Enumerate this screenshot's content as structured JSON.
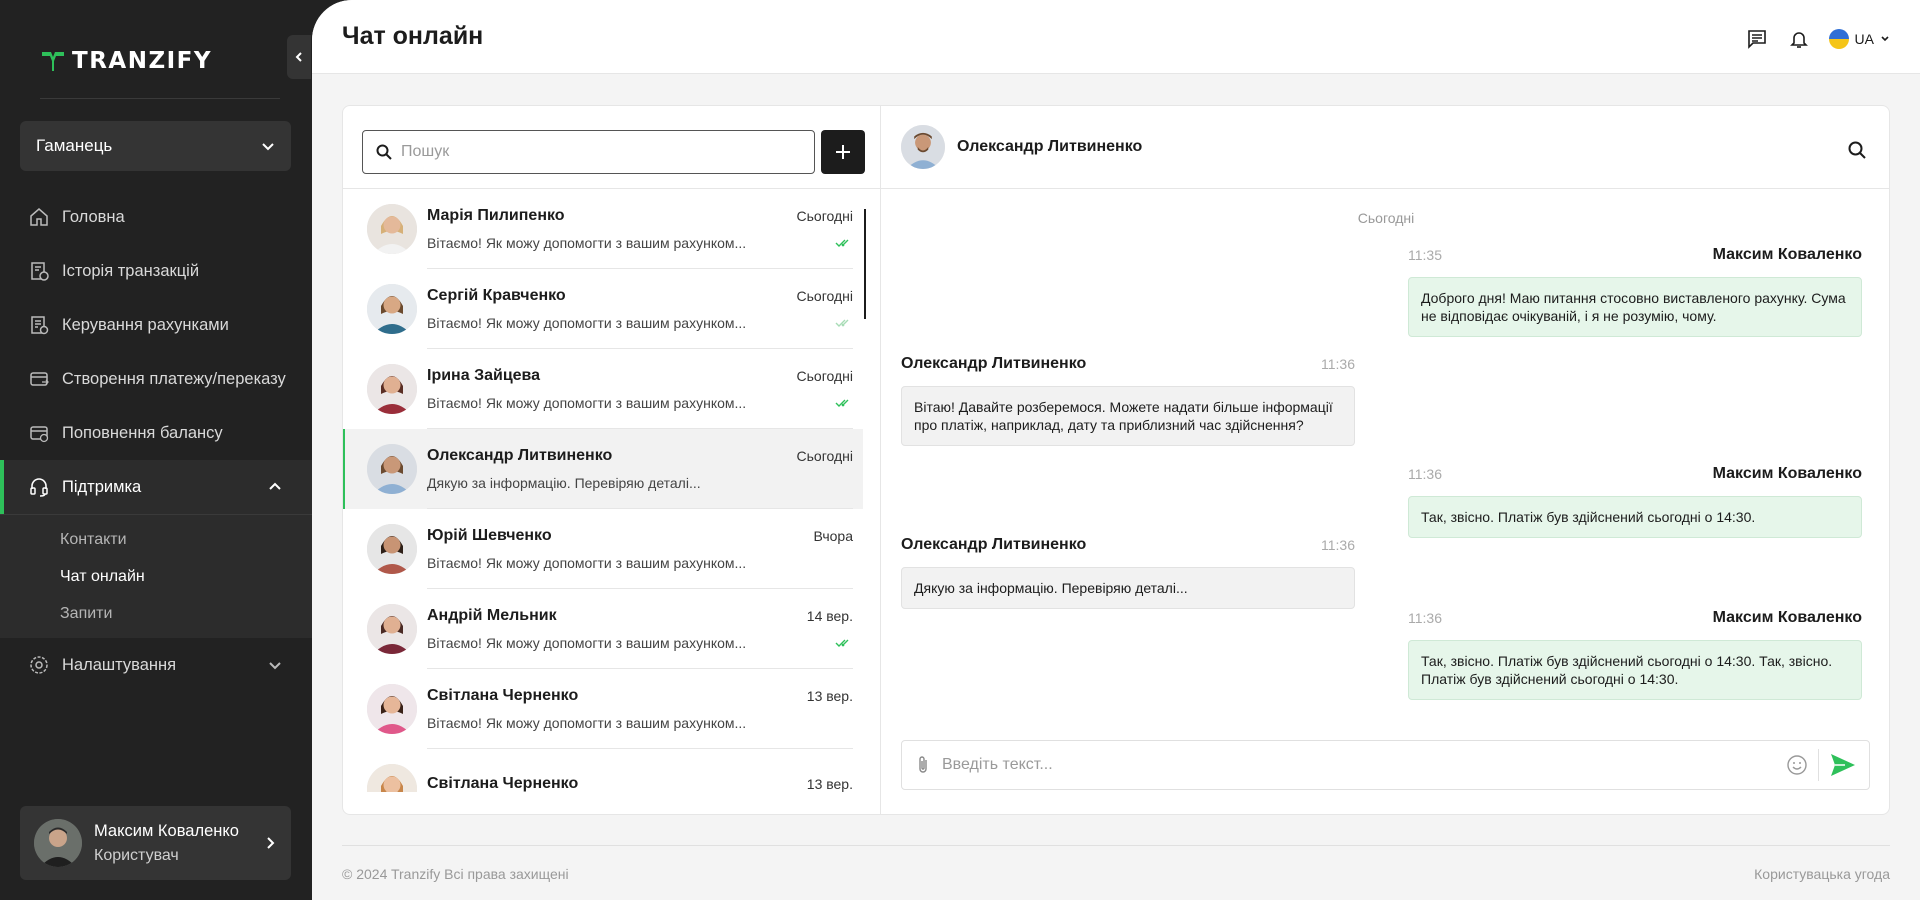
{
  "app": {
    "brand": "TRANZIFY",
    "accent_color": "#2ec05a",
    "sidebar_bg": "#222222"
  },
  "sidebar": {
    "wallet_label": "Гаманець",
    "nav": [
      {
        "label": "Головна",
        "icon": "home-icon"
      },
      {
        "label": "Історія транзакцій",
        "icon": "history-icon"
      },
      {
        "label": "Керування рахунками",
        "icon": "accounts-icon"
      },
      {
        "label": "Створення платежу/переказу",
        "icon": "payment-icon"
      },
      {
        "label": "Поповнення балансу",
        "icon": "topup-icon"
      },
      {
        "label": "Підтримка",
        "icon": "headset-icon",
        "active": true
      },
      {
        "label": "Налаштування",
        "icon": "gear-icon"
      }
    ],
    "support_sub": [
      "Контакти",
      "Чат онлайн",
      "Запити"
    ],
    "user": {
      "name": "Максим Коваленко",
      "role": "Користувач"
    }
  },
  "header": {
    "title": "Чат онлайн",
    "language": "UA"
  },
  "chat_list": {
    "search_placeholder": "Пошук",
    "items": [
      {
        "name": "Марія Пилипенко",
        "time": "Сьогодні",
        "preview": "Вітаємо! Як можу допомогти з вашим рахунком...",
        "status": "read"
      },
      {
        "name": "Сергій Кравченко",
        "time": "Сьогодні",
        "preview": "Вітаємо! Як можу допомогти з вашим рахунком...",
        "status": "delivered"
      },
      {
        "name": "Ірина Зайцева",
        "time": "Сьогодні",
        "preview": "Вітаємо! Як можу допомогти з вашим рахунком...",
        "status": "read"
      },
      {
        "name": "Олександр Литвиненко",
        "time": "Сьогодні",
        "preview": "Дякую за інформацію. Перевіряю деталі...",
        "status": "none",
        "active": true
      },
      {
        "name": "Юрій Шевченко",
        "time": "Вчора",
        "preview": "Вітаємо! Як можу допомогти з вашим рахунком...",
        "status": "none"
      },
      {
        "name": "Андрій Мельник",
        "time": "14 вер.",
        "preview": "Вітаємо! Як можу допомогти з вашим рахунком...",
        "status": "read"
      },
      {
        "name": "Світлана Черненко",
        "time": "13 вер.",
        "preview": "Вітаємо! Як можу допомогти з вашим рахунком...",
        "status": "none"
      },
      {
        "name": "Світлана Черненко",
        "time": "13 вер.",
        "preview": "",
        "status": "none"
      }
    ]
  },
  "conversation": {
    "contact_name": "Олександр Литвиненко",
    "day_label": "Сьогодні",
    "messages": [
      {
        "author": "Максим Коваленко",
        "time": "11:35",
        "text": "Доброго дня! Маю питання стосовно виставленого рахунку. Сума не відповідає очікуваній, і я не розумію, чому.",
        "side": "out"
      },
      {
        "author": "Олександр Литвиненко",
        "time": "11:36",
        "text": "Вітаю! Давайте розберемося. Можете надати більше інформації про платіж, наприклад, дату та приблизний час здійснення?",
        "side": "in"
      },
      {
        "author": "Максим Коваленко",
        "time": "11:36",
        "text": "Так, звісно. Платіж був здійснений сьогодні о 14:30.",
        "side": "out"
      },
      {
        "author": "Олександр Литвиненко",
        "time": "11:36",
        "text": "Дякую за інформацію. Перевіряю деталі...",
        "side": "in"
      },
      {
        "author": "Максим Коваленко",
        "time": "11:36",
        "text": "Так, звісно. Платіж був здійснений сьогодні о 14:30. Так, звісно. Платіж був здійснений сьогодні о 14:30.",
        "side": "out"
      }
    ],
    "input_placeholder": "Введіть текст..."
  },
  "footer": {
    "copyright": "© 2024 Tranzify Всі права захищені",
    "agreement": "Користувацька угода"
  }
}
